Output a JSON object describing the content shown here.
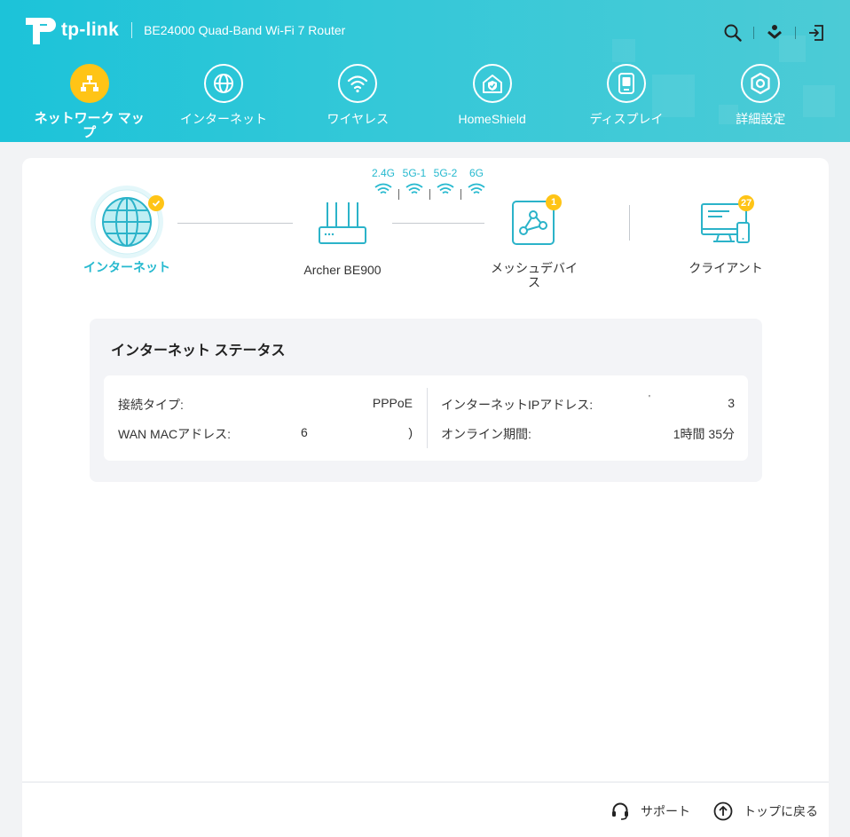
{
  "header": {
    "brand": "tp-link",
    "model": "BE24000 Quad-Band Wi-Fi 7 Router",
    "icons": [
      "search-icon",
      "download-icon",
      "logout-icon"
    ]
  },
  "nav": {
    "items": [
      {
        "label": "ネットワーク マップ",
        "icon": "network-map-icon",
        "active": true
      },
      {
        "label": "インターネット",
        "icon": "globe-icon"
      },
      {
        "label": "ワイヤレス",
        "icon": "wifi-icon"
      },
      {
        "label": "HomeShield",
        "icon": "homeshield-icon"
      },
      {
        "label": "ディスプレイ",
        "icon": "display-icon"
      },
      {
        "label": "詳細設定",
        "icon": "gear-icon"
      }
    ]
  },
  "topology": {
    "internet": {
      "label": "インターネット"
    },
    "router": {
      "label": "Archer BE900"
    },
    "mesh": {
      "label": "メッシュデバイス",
      "count": "1"
    },
    "clients": {
      "label": "クライアント",
      "count": "27"
    },
    "bands": [
      "2.4G",
      "5G-1",
      "5G-2",
      "6G"
    ]
  },
  "status": {
    "title": "インターネット ステータス",
    "connection_type_label": "接続タイプ:",
    "connection_type_value": "PPPoE",
    "wan_mac_label": "WAN MACアドレス:",
    "wan_mac_value_start": "6",
    "wan_mac_value_end": ")",
    "ip_label": "インターネットIPアドレス:",
    "ip_value_start": "'",
    "ip_value_end": "3",
    "uptime_label": "オンライン期間:",
    "uptime_value": "1時間 35分"
  },
  "footer": {
    "support": "サポート",
    "back_to_top": "トップに戻る"
  },
  "colors": {
    "accent": "#26b9cf",
    "header_start": "#1cc3d9",
    "header_end": "#4ccbd6",
    "badge": "#ffc416"
  }
}
